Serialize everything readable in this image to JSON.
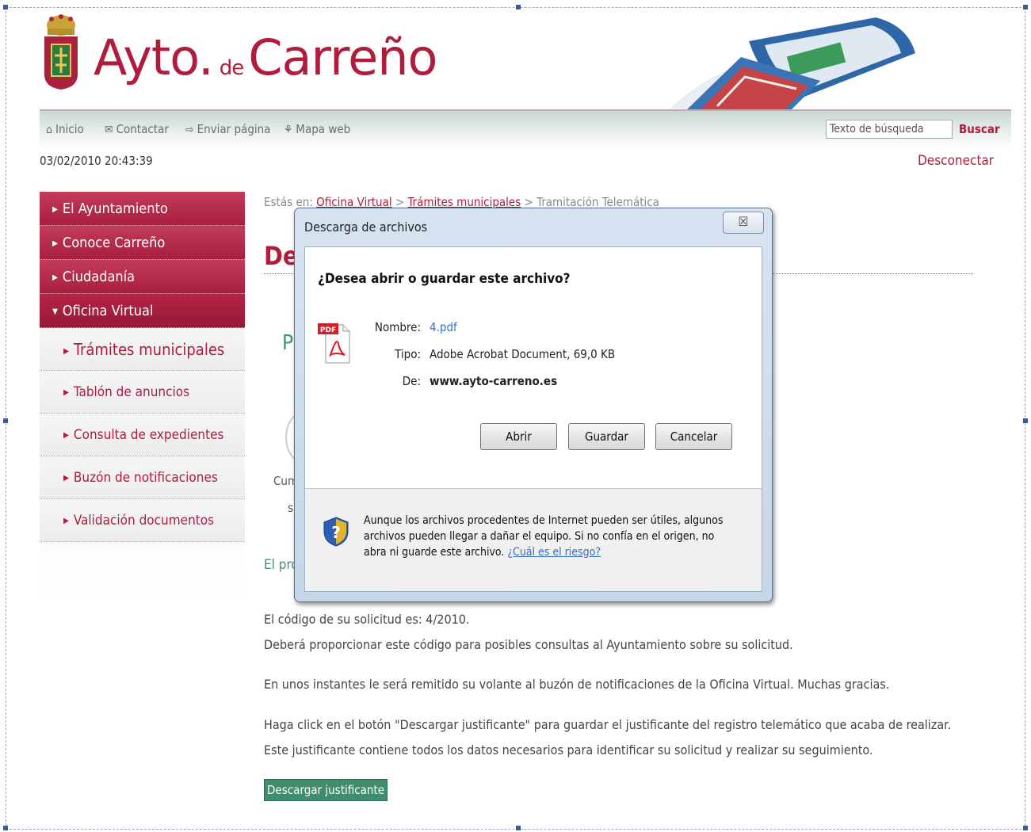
{
  "site": {
    "logo_text": "Ayto.",
    "logo_de": "de",
    "logo_name": "Carreño"
  },
  "nav": {
    "items": [
      {
        "icon": "home-icon",
        "label": "Inicio"
      },
      {
        "icon": "mail-icon",
        "label": "Contactar"
      },
      {
        "icon": "send-page-icon",
        "label": "Enviar página"
      },
      {
        "icon": "sitemap-icon",
        "label": "Mapa web"
      }
    ],
    "search_value": "Texto de búsqueda",
    "search_button": "Buscar"
  },
  "datetime": "03/02/2010 20:43:39",
  "logout": "Desconectar",
  "sidebar": {
    "main": [
      {
        "label": "El Ayuntamiento"
      },
      {
        "label": "Conoce Carreño"
      },
      {
        "label": "Ciudadanía"
      },
      {
        "label": "Oficina Virtual"
      }
    ],
    "sub": [
      {
        "label": "Trámites municipales"
      },
      {
        "label": "Tablón de anuncios"
      },
      {
        "label": "Consulta de expedientes"
      },
      {
        "label": "Buzón de notificaciones"
      },
      {
        "label": "Validación documentos"
      }
    ]
  },
  "breadcrumb": {
    "prefix": "Estás en:",
    "items": [
      "Oficina Virtual",
      "Trámites municipales",
      "Tramitación Telemática"
    ],
    "sep": ">"
  },
  "content": {
    "title_fragment": "De",
    "sub_fragment": "P",
    "frag_cum": "Cum",
    "frag_s": "s",
    "frag_elpro": "El pro",
    "code_line": "El código de su solicitud es: 4/2010.",
    "code_note": "Deberá proporcionar este código para posibles consultas al Ayuntamiento sobre su solicitud.",
    "notify": "En unos instantes le será remitido su volante al buzón de notificaciones de la Oficina Virtual. Muchas gracias.",
    "click_info": "Haga click en el botón \"Descargar justificante\" para guardar el justificante del registro telemático que acaba de realizar.",
    "contains": "Este justificante contiene todos los datos necesarios para identificar su solicitud y realizar su seguimiento.",
    "download_button": "Descargar justificante"
  },
  "dialog": {
    "title": "Descarga de archivos",
    "close": "☒",
    "question": "¿Desea abrir o guardar este archivo?",
    "name_label": "Nombre:",
    "name_value": "4.pdf",
    "type_label": "Tipo:",
    "type_value": "Adobe Acrobat Document, 69,0 KB",
    "from_label": "De:",
    "from_value": "www.ayto-carreno.es",
    "btn_open": "Abrir",
    "btn_save": "Guardar",
    "btn_cancel": "Cancelar",
    "warning": "Aunque los archivos procedentes de Internet pueden ser útiles, algunos archivos pueden llegar a dañar el equipo. Si no confía en el origen, no abra ni guarde este archivo.",
    "risk_link": "¿Cuál es el riesgo?",
    "pdf_badge": "PDF"
  },
  "colors": {
    "brand": "#b01c3c",
    "green": "#3f8d6d",
    "link": "#3b6fc4"
  }
}
